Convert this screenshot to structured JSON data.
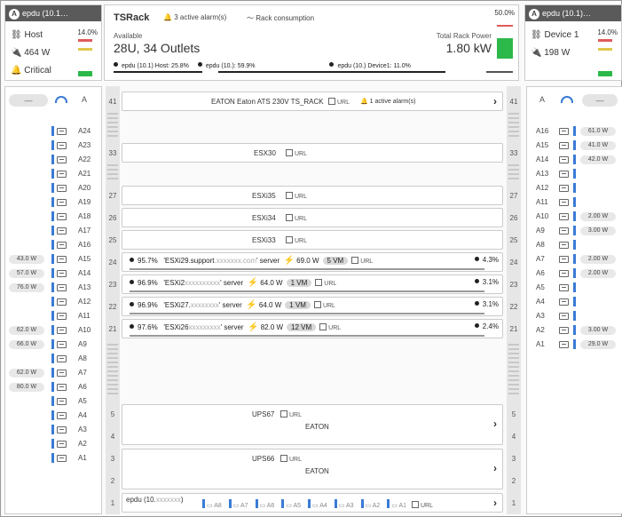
{
  "left_pdu": {
    "title": "epdu (10.1",
    "device_label": "Host",
    "power": "464 W",
    "status": "Critical",
    "pct": "14.0%",
    "fill_fraction": 0.14
  },
  "right_pdu": {
    "title": "epdu (10.1",
    "device_label": "Device 1",
    "power": "198 W",
    "pct": "14.0%",
    "fill_fraction": 0.14
  },
  "rack": {
    "name": "TSRack",
    "alarms": "3 active alarm(s)",
    "consumption": "Rack consumption",
    "available_label": "Available",
    "available_value": "28U, 34 Outlets",
    "total_label": "Total Rack Power",
    "total_value": "1.80 kW",
    "pct": "50.0%",
    "fill_fraction": 0.5,
    "loads": [
      "epdu (10.1",
      "Host: 25.8%",
      "epdu (10.",
      "59.9%",
      "epdu (10.",
      "Device1: 11.0%"
    ]
  },
  "left_side": {
    "pill": "—",
    "letter": "A"
  },
  "right_side": {
    "pill": "—",
    "letter": "A"
  },
  "left_outlets": [
    {
      "id": "A24",
      "power": ""
    },
    {
      "id": "A23",
      "power": ""
    },
    {
      "id": "A22",
      "power": ""
    },
    {
      "id": "A21",
      "power": ""
    },
    {
      "id": "A20",
      "power": ""
    },
    {
      "id": "A19",
      "power": ""
    },
    {
      "id": "A18",
      "power": ""
    },
    {
      "id": "A17",
      "power": ""
    },
    {
      "id": "A16",
      "power": ""
    },
    {
      "id": "A15",
      "power": "43.0 W"
    },
    {
      "id": "A14",
      "power": "57.0 W"
    },
    {
      "id": "A13",
      "power": "76.0 W"
    },
    {
      "id": "A12",
      "power": ""
    },
    {
      "id": "A11",
      "power": ""
    },
    {
      "id": "A10",
      "power": "62.0 W"
    },
    {
      "id": "A9",
      "power": "66.0 W"
    },
    {
      "id": "A8",
      "power": ""
    },
    {
      "id": "A7",
      "power": "62.0 W"
    },
    {
      "id": "A6",
      "power": "80.0 W"
    },
    {
      "id": "A5",
      "power": ""
    },
    {
      "id": "A4",
      "power": ""
    },
    {
      "id": "A3",
      "power": ""
    },
    {
      "id": "A2",
      "power": ""
    },
    {
      "id": "A1",
      "power": ""
    }
  ],
  "right_outlets": [
    {
      "id": "A16",
      "power": "61.0 W"
    },
    {
      "id": "A15",
      "power": "41.0 W"
    },
    {
      "id": "A14",
      "power": "42.0 W"
    },
    {
      "id": "A13",
      "power": ""
    },
    {
      "id": "A12",
      "power": ""
    },
    {
      "id": "A11",
      "power": ""
    },
    {
      "id": "A10",
      "power": "2.00 W"
    },
    {
      "id": "A9",
      "power": "3.00 W"
    },
    {
      "id": "A8",
      "power": ""
    },
    {
      "id": "A7",
      "power": "2.00 W"
    },
    {
      "id": "A6",
      "power": "2.00 W"
    },
    {
      "id": "A5",
      "power": ""
    },
    {
      "id": "A4",
      "power": ""
    },
    {
      "id": "A3",
      "power": ""
    },
    {
      "id": "A2",
      "power": "3.00 W"
    },
    {
      "id": "A1",
      "power": "29.0 W"
    }
  ],
  "devices": {
    "ats": {
      "name": "EATON Eaton ATS 230V TS_RACK",
      "url": "URL",
      "alarm": "1 active alarm(s)",
      "u": "41"
    },
    "esx30": {
      "name": "ESX30",
      "url": "URL",
      "u": "33"
    },
    "esxi35": {
      "name": "ESXi35",
      "url": "URL",
      "u": "27"
    },
    "esxi34": {
      "name": "ESXi34",
      "url": "URL",
      "u": "26"
    },
    "esxi33": {
      "name": "ESXi33",
      "url": "URL",
      "u": "25"
    },
    "servers": [
      {
        "u": "24",
        "cpu": "95.7%",
        "name": "'ESXi29.support",
        "suffix": "' server",
        "power": "69.0 W",
        "vm": "5 VM",
        "url": "URL",
        "pct": "4.3%",
        "load": 0.043
      },
      {
        "u": "23",
        "cpu": "96.9%",
        "name": "'ESXi2",
        "suffix": "' server",
        "power": "64.0 W",
        "vm": "1 VM",
        "url": "URL",
        "pct": "3.1%",
        "load": 0.031
      },
      {
        "u": "22",
        "cpu": "96.9%",
        "name": "'ESXi27.",
        "suffix": "' server",
        "power": "64.0 W",
        "vm": "1 VM",
        "url": "URL",
        "pct": "3.1%",
        "load": 0.031
      },
      {
        "u": "21",
        "cpu": "97.6%",
        "name": "'ESXi26",
        "suffix": "' server",
        "power": "82.0 W",
        "vm": "12 VM",
        "url": "URL",
        "pct": "2.4%",
        "load": 0.024
      }
    ],
    "ups67": {
      "name": "UPS67",
      "url": "URL",
      "vendor": "EATON",
      "u_top": "5",
      "u_bot": "4"
    },
    "ups66": {
      "name": "UPS66",
      "url": "URL",
      "vendor": "EATON",
      "u_top": "3",
      "u_bot": "2"
    },
    "epdu_bottom": {
      "name": "epdu (10.",
      "suffix": ")",
      "u": "1",
      "url": "URL",
      "outlets": [
        "A8",
        "A7",
        "A6",
        "A5",
        "A4",
        "A3",
        "A2",
        "A1"
      ]
    }
  },
  "icons": {
    "alarm": "bell-icon",
    "link": "link-icon",
    "plug": "plug-icon",
    "bolt": "bolt-icon",
    "outlet": "outlet-icon",
    "external": "external-link-icon",
    "chevron": "chevron-right-icon"
  },
  "colors": {
    "accent": "#3a7bd5",
    "ok": "#2db84a",
    "alarm": "#d9342b",
    "header": "#5a5a5a"
  }
}
